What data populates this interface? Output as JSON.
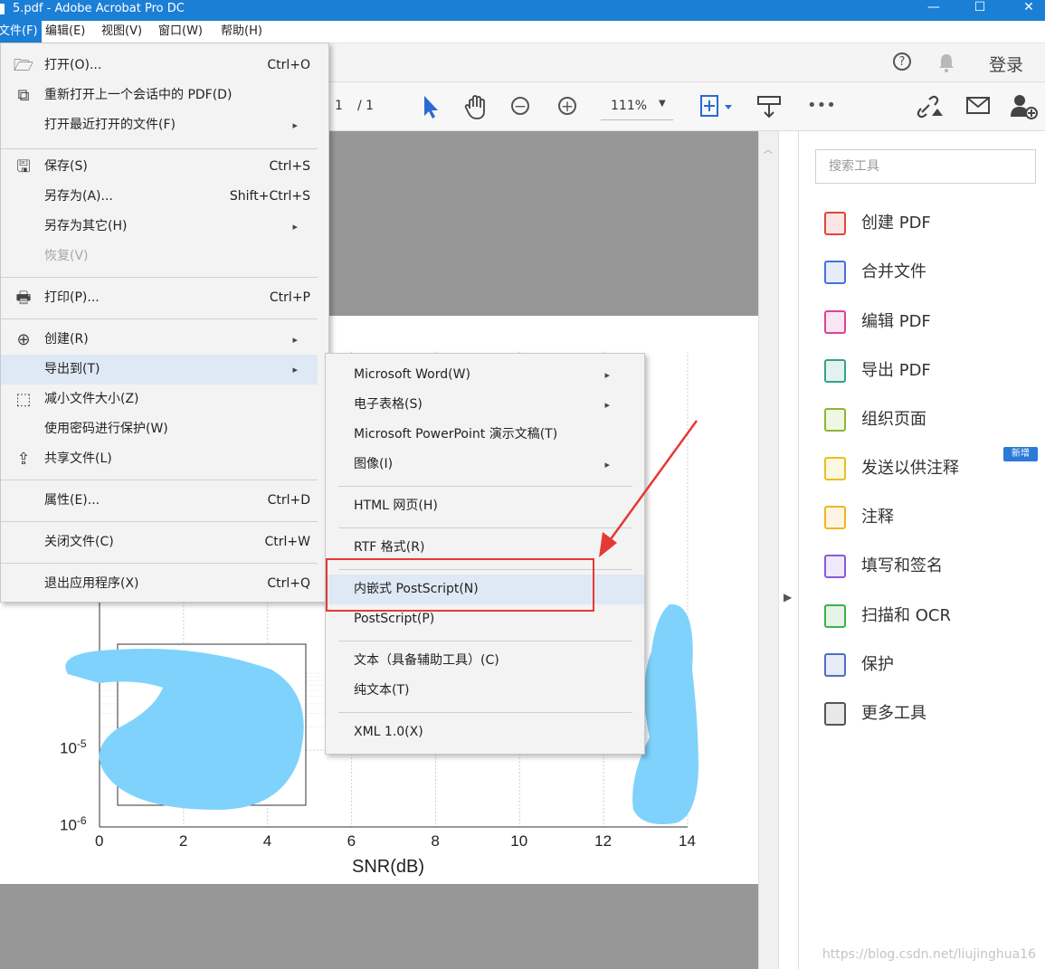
{
  "window": {
    "title": "5.pdf - Adobe Acrobat Pro DC",
    "minimize": "—",
    "maximize": "☐",
    "close": "✕"
  },
  "menubar": [
    {
      "label": "文件(F)",
      "active": true
    },
    {
      "label": "编辑(E)"
    },
    {
      "label": "视图(V)"
    },
    {
      "label": "窗口(W)"
    },
    {
      "label": "帮助(H)"
    }
  ],
  "header": {
    "help_icon": "?",
    "bell_icon": "bell",
    "login": "登录"
  },
  "toolbar": {
    "page_current": "1",
    "page_total": "/ 1",
    "zoom": "111%",
    "more": "•••"
  },
  "file_menu": [
    {
      "label": "打开(O)...",
      "shortcut": "Ctrl+O",
      "icon": "folder-open-icon"
    },
    {
      "label": "重新打开上一个会话中的 PDF(D)",
      "shortcut": "",
      "icon": "reopen-icon"
    },
    {
      "label": "打开最近打开的文件(F)",
      "shortcut": "",
      "submenu": true
    },
    {
      "label": "保存(S)",
      "shortcut": "Ctrl+S",
      "icon": "save-icon"
    },
    {
      "label": "另存为(A)...",
      "shortcut": "Shift+Ctrl+S"
    },
    {
      "label": "另存为其它(H)",
      "shortcut": "",
      "submenu": true
    },
    {
      "label": "恢复(V)",
      "shortcut": "",
      "disabled": true
    },
    {
      "label": "打印(P)...",
      "shortcut": "Ctrl+P",
      "icon": "print-icon"
    },
    {
      "label": "创建(R)",
      "shortcut": "",
      "submenu": true,
      "icon": "create-icon"
    },
    {
      "label": "导出到(T)",
      "shortcut": "",
      "submenu": true,
      "highlight": true
    },
    {
      "label": "减小文件大小(Z)",
      "shortcut": "",
      "icon": "compress-icon"
    },
    {
      "label": "使用密码进行保护(W)",
      "shortcut": ""
    },
    {
      "label": "共享文件(L)",
      "shortcut": "",
      "icon": "share-icon"
    },
    {
      "label": "属性(E)...",
      "shortcut": "Ctrl+D"
    },
    {
      "label": "关闭文件(C)",
      "shortcut": "Ctrl+W"
    },
    {
      "label": "退出应用程序(X)",
      "shortcut": "Ctrl+Q"
    }
  ],
  "export_submenu": [
    {
      "label": "Microsoft Word(W)",
      "submenu": true
    },
    {
      "label": "电子表格(S)",
      "submenu": true
    },
    {
      "label": "Microsoft PowerPoint 演示文稿(T)"
    },
    {
      "label": "图像(I)",
      "submenu": true
    },
    {
      "label": "HTML 网页(H)"
    },
    {
      "label": "RTF 格式(R)"
    },
    {
      "label": "内嵌式 PostScript(N)",
      "highlight": true
    },
    {
      "label": "PostScript(P)"
    },
    {
      "label": "文本（具备辅助工具）(C)"
    },
    {
      "label": "纯文本(T)"
    },
    {
      "label": "XML 1.0(X)"
    }
  ],
  "tool_pane": {
    "search_placeholder": "搜索工具",
    "badge_new": "新增",
    "tools": [
      {
        "label": "创建 PDF",
        "icon": "create-pdf-icon",
        "color": "#e0463a"
      },
      {
        "label": "合并文件",
        "icon": "combine-files-icon",
        "color": "#4a6fd8"
      },
      {
        "label": "编辑 PDF",
        "icon": "edit-pdf-icon",
        "color": "#d9449a"
      },
      {
        "label": "导出 PDF",
        "icon": "export-pdf-icon",
        "color": "#35a18a"
      },
      {
        "label": "组织页面",
        "icon": "organize-pages-icon",
        "color": "#8bb830"
      },
      {
        "label": "发送以供注释",
        "icon": "send-comments-icon",
        "color": "#e8c020"
      },
      {
        "label": "注释",
        "icon": "comment-icon",
        "color": "#f0b61e"
      },
      {
        "label": "填写和签名",
        "icon": "fill-sign-icon",
        "color": "#8a5ad8"
      },
      {
        "label": "扫描和 OCR",
        "icon": "scan-ocr-icon",
        "color": "#3db04a"
      },
      {
        "label": "保护",
        "icon": "protect-icon",
        "color": "#4c6ec4"
      },
      {
        "label": "更多工具",
        "icon": "more-tools-icon",
        "color": "#555555"
      }
    ]
  },
  "chart_data": {
    "type": "line",
    "xlabel": "SNR(dB)",
    "ylabel": "",
    "xlim": [
      0,
      14
    ],
    "x_ticks": [
      "0",
      "2",
      "4",
      "6",
      "8",
      "10",
      "12",
      "14"
    ],
    "y_scale": "log",
    "y_ticks_visible": [
      {
        "base": "10",
        "exp": "-5"
      },
      {
        "base": "10",
        "exp": "-6"
      }
    ],
    "grid": true,
    "legend": "bottom-left, content obscured",
    "series": []
  },
  "watermark": "https://blog.csdn.net/liujinghua16"
}
